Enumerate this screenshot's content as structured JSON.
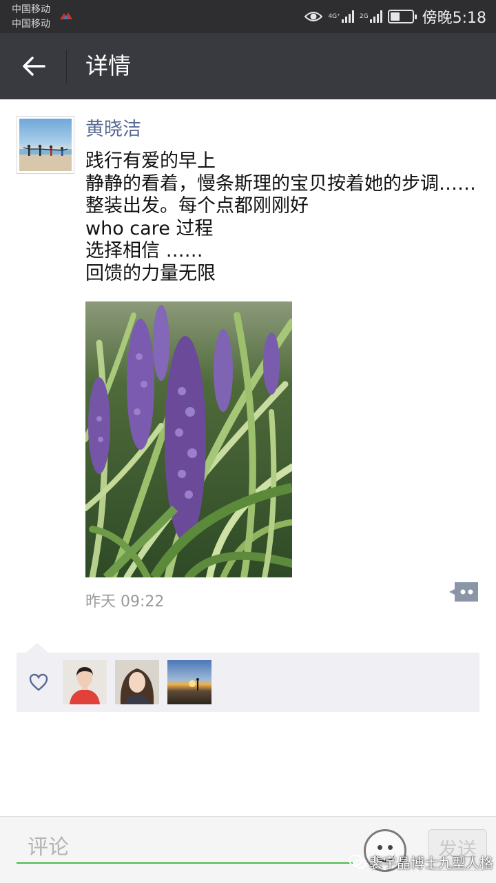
{
  "status_bar": {
    "carrier_1": "中国移动",
    "carrier_2": "中国移动",
    "network_1": "4G⁺",
    "network_2": "2G",
    "time": "傍晚5:18",
    "battery_level": 0.45,
    "icons": [
      "eye-icon",
      "signal-icon",
      "battery-icon"
    ]
  },
  "header": {
    "title": "详情",
    "back_icon": "arrow-left-icon",
    "background": "#393a3f"
  },
  "post": {
    "author": "黄晓洁",
    "author_color": "#576b95",
    "lines": [
      "践行有爱的早上",
      "静静的看着，慢条斯理的宝贝按着她的步调……",
      "整装出发。每个点都刚刚好",
      "who care 过程",
      "选择相信 ……",
      "回馈的力量无限"
    ],
    "time": "昨天 09:22",
    "more_icon": "more-comment-icon"
  },
  "likes": {
    "icon": "heart-icon",
    "count_shown": 3
  },
  "comment_bar": {
    "placeholder": "评论",
    "send_label": "发送",
    "emoji_icon": "emoji-face-icon",
    "accent": "#4cb84a"
  },
  "watermark": {
    "text": "裴宇晶博士九型人格"
  }
}
